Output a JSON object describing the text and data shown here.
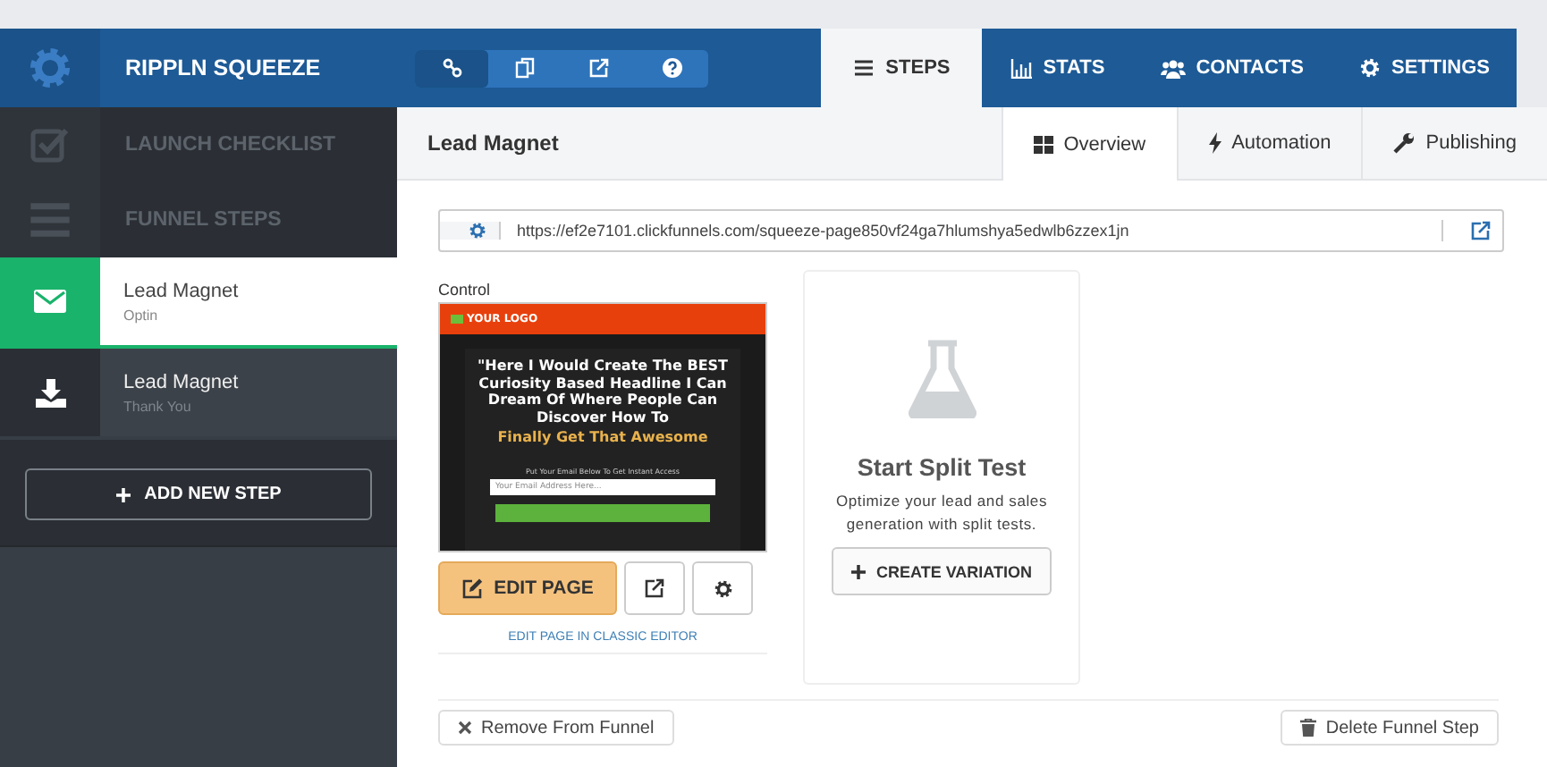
{
  "app": {
    "title": "RIPPLN SQUEEZE"
  },
  "toolbar": [
    {
      "selected": true
    },
    {
      "selected": false
    },
    {
      "selected": false
    },
    {
      "selected": false
    }
  ],
  "nav_tabs": [
    {
      "label": "STEPS",
      "selected": true
    },
    {
      "label": "STATS",
      "selected": false
    },
    {
      "label": "CONTACTS",
      "selected": false
    },
    {
      "label": "SETTINGS",
      "selected": false
    }
  ],
  "sidebar": {
    "sections": [
      {
        "label": "LAUNCH CHECKLIST"
      },
      {
        "label": "FUNNEL STEPS"
      }
    ],
    "steps": [
      {
        "title": "Lead Magnet",
        "subtitle": "Optin",
        "selected": true
      },
      {
        "title": "Lead Magnet",
        "subtitle": "Thank You",
        "selected": false
      }
    ],
    "add_button": "ADD NEW STEP"
  },
  "page": {
    "title": "Lead Magnet",
    "tabs": [
      {
        "label": "Overview",
        "selected": true
      },
      {
        "label": "Automation",
        "selected": false
      },
      {
        "label": "Publishing",
        "selected": false
      }
    ],
    "url": "https://ef2e7101.clickfunnels.com/squeeze-page850vf24ga7hlumshya5edwlb6zzex1jn",
    "control_label": "Control",
    "preview": {
      "logo": "YOUR LOGO",
      "headline": "\"Here I Would Create The BEST Curiosity Based Headline I Can Dream Of Where People Can Discover How To",
      "highlight": "Finally Get That Awesome",
      "prompt": "Put Your Email Below To Get Instant Access",
      "email_placeholder": "Your Email Address Here..."
    },
    "edit_button": "EDIT PAGE",
    "classic_link": "EDIT PAGE IN CLASSIC EDITOR",
    "split_test": {
      "title": "Start Split Test",
      "text": "Optimize your lead and sales generation with split tests.",
      "button": "CREATE VARIATION"
    },
    "footer_buttons": [
      {
        "label": "Remove From Funnel"
      },
      {
        "label": "Delete Funnel Step"
      }
    ]
  }
}
